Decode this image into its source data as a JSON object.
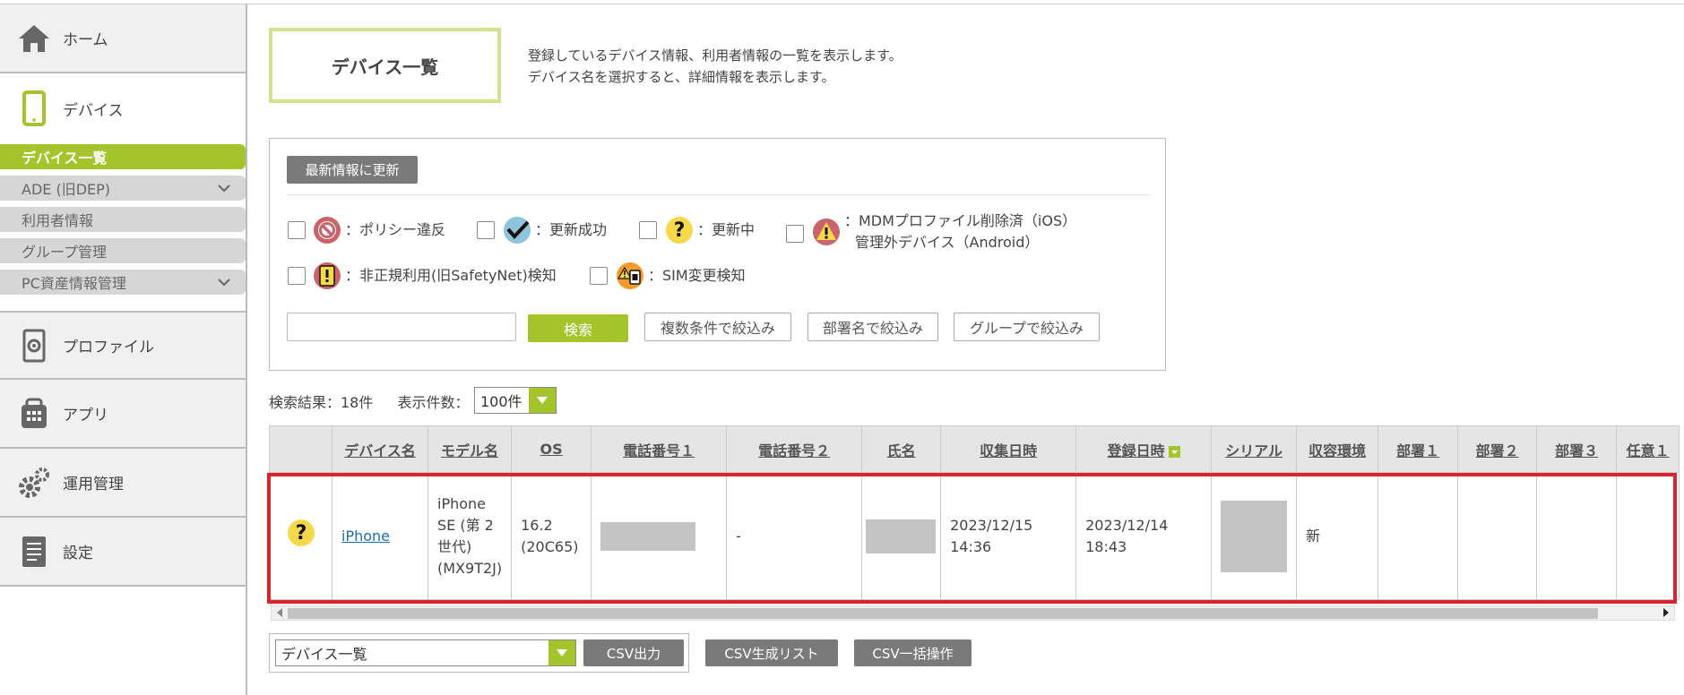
{
  "sidebar": {
    "home": {
      "label": "ホーム"
    },
    "device": {
      "label": "デバイス"
    },
    "sub_items": [
      {
        "label": "デバイス一覧",
        "active": true
      },
      {
        "label": "ADE (旧DEP)",
        "expand": true
      },
      {
        "label": "利用者情報"
      },
      {
        "label": "グループ管理"
      },
      {
        "label": "PC資産情報管理",
        "expand": true
      }
    ],
    "profile": {
      "label": "プロファイル"
    },
    "app": {
      "label": "アプリ"
    },
    "ops": {
      "label": "運用管理"
    },
    "settings": {
      "label": "設定"
    }
  },
  "page": {
    "title": "デバイス一覧",
    "desc_line1": "登録しているデバイス情報、利用者情報の一覧を表示します。",
    "desc_line2": "デバイス名を選択すると、詳細情報を表示します。"
  },
  "filter": {
    "refresh_label": "最新情報に更新",
    "status_filters": [
      {
        "icon": "prohibited-icon",
        "label": "：ポリシー違反"
      },
      {
        "icon": "checkmark-icon",
        "label": "：更新成功"
      },
      {
        "icon": "question-icon",
        "label": "：更新中"
      },
      {
        "icon": "warning-icon",
        "label_line1": "：MDMプロファイル削除済（iOS）",
        "label_line2": "管理外デバイス（Android）"
      },
      {
        "icon": "exclamation-icon",
        "label": "：非正規利用(旧SafetyNet)検知"
      },
      {
        "icon": "sim-warning-icon",
        "label": "：SIM変更検知"
      }
    ],
    "search_value": "",
    "search_button": "検索",
    "multi_filter": "複数条件で絞込み",
    "dept_filter": "部署名で絞込み",
    "group_filter": "グループで絞込み"
  },
  "results": {
    "summary": "検索結果：18件",
    "per_page_label": "表示件数：",
    "per_page_value": "100件"
  },
  "table": {
    "columns": [
      "",
      "デバイス名",
      "モデル名",
      "OS",
      "電話番号１",
      "電話番号２",
      "氏名",
      "収集日時",
      "登録日時",
      "シリアル",
      "収容環境",
      "部署１",
      "部署２",
      "部署３",
      "任意１"
    ],
    "sorted_column": "登録日時",
    "rows": [
      {
        "status_icon": "question-icon",
        "device_name": "iPhone",
        "model": "iPhone SE (第 2 世代) (MX9T2J)",
        "os": "16.2 (20C65)",
        "phone1": "",
        "phone2": "-",
        "name": "",
        "collected": "2023/12/15 14:36",
        "registered": "2023/12/14 18:43",
        "serial": "",
        "env": "新",
        "dept1": "",
        "dept2": "",
        "dept3": "",
        "any1": ""
      }
    ]
  },
  "bottom": {
    "export_select": "デバイス一覧",
    "csv_output": "CSV出力",
    "csv_list": "CSV生成リスト",
    "csv_bulk": "CSV一括操作"
  },
  "colors": {
    "accent_green": "#a3c42b",
    "highlight_red": "#d9232e",
    "title_border": "#d4e28f"
  }
}
